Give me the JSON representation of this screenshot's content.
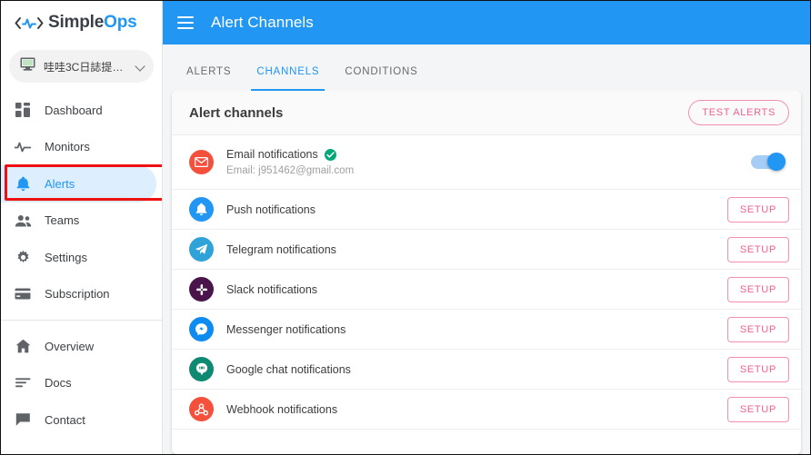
{
  "brand": {
    "name_primary": "Simple",
    "name_accent": "Ops",
    "logo_icon": "activity-pulse-icon"
  },
  "sidebar": {
    "workspace": {
      "label": "哇哇3C日誌提…",
      "icon": "monitor-icon",
      "chevron": "chevron-down-icon"
    },
    "items": [
      {
        "label": "Dashboard",
        "icon": "dashboard-icon",
        "active": false
      },
      {
        "label": "Monitors",
        "icon": "pulse-icon",
        "active": false
      },
      {
        "label": "Alerts",
        "icon": "bell-icon",
        "active": true
      },
      {
        "label": "Teams",
        "icon": "people-icon",
        "active": false
      },
      {
        "label": "Settings",
        "icon": "gear-icon",
        "active": false
      },
      {
        "label": "Subscription",
        "icon": "credit-card-icon",
        "active": false
      },
      {
        "label": "Overview",
        "icon": "home-icon",
        "active": false
      },
      {
        "label": "Docs",
        "icon": "docs-icon",
        "active": false
      },
      {
        "label": "Contact",
        "icon": "chat-icon",
        "active": false
      }
    ]
  },
  "topbar": {
    "menu_icon": "hamburger-icon",
    "title": "Alert Channels",
    "background": "#2196f3"
  },
  "tabs": [
    {
      "label": "ALERTS",
      "active": false
    },
    {
      "label": "CHANNELS",
      "active": true
    },
    {
      "label": "CONDITIONS",
      "active": false
    }
  ],
  "card": {
    "title": "Alert channels",
    "test_button": "TEST ALERTS",
    "setup_button": "SETUP",
    "accent_pink": "#f06292",
    "channels": [
      {
        "name": "Email notifications",
        "sub": "Email: j951462@gmail.com",
        "icon": "email-icon",
        "icon_color": "#f4503c",
        "verified": true,
        "control": "toggle",
        "toggle_on": true
      },
      {
        "name": "Push notifications",
        "sub": "",
        "icon": "bell-icon",
        "icon_color": "#2196f3",
        "verified": false,
        "control": "setup"
      },
      {
        "name": "Telegram notifications",
        "sub": "",
        "icon": "telegram-icon",
        "icon_color": "#2fa3d8",
        "verified": false,
        "control": "setup"
      },
      {
        "name": "Slack notifications",
        "sub": "",
        "icon": "slack-icon",
        "icon_color": "#4a154b",
        "verified": false,
        "control": "setup"
      },
      {
        "name": "Messenger notifications",
        "sub": "",
        "icon": "messenger-icon",
        "icon_color": "#0d8bf0",
        "verified": false,
        "control": "setup"
      },
      {
        "name": "Google chat notifications",
        "sub": "",
        "icon": "google-chat-icon",
        "icon_color": "#0f8a72",
        "verified": false,
        "control": "setup"
      },
      {
        "name": "Webhook notifications",
        "sub": "",
        "icon": "webhook-icon",
        "icon_color": "#f4503c",
        "verified": false,
        "control": "setup"
      }
    ]
  }
}
